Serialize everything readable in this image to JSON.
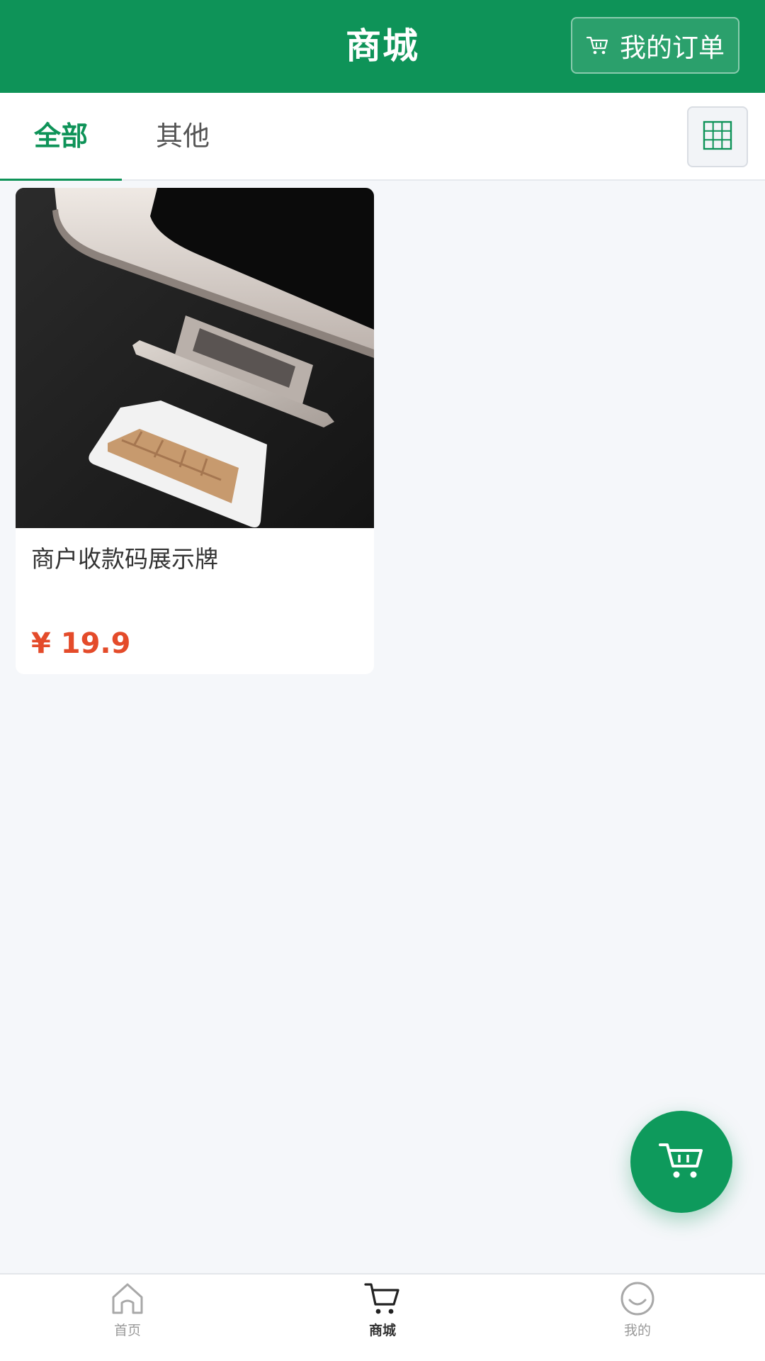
{
  "header": {
    "title": "商城",
    "orders_button": "我的订单"
  },
  "tabs": [
    {
      "label": "全部",
      "active": true
    },
    {
      "label": "其他",
      "active": false
    }
  ],
  "products": [
    {
      "name": "商户收款码展示牌",
      "price": "¥ 19.9"
    }
  ],
  "bottom_nav": [
    {
      "label": "首页",
      "icon": "home-icon",
      "active": false
    },
    {
      "label": "商城",
      "icon": "cart-icon",
      "active": true
    },
    {
      "label": "我的",
      "icon": "smile-icon",
      "active": false
    }
  ],
  "colors": {
    "brand": "#0e9358",
    "price": "#e44b2a",
    "background": "#f5f7fa"
  }
}
